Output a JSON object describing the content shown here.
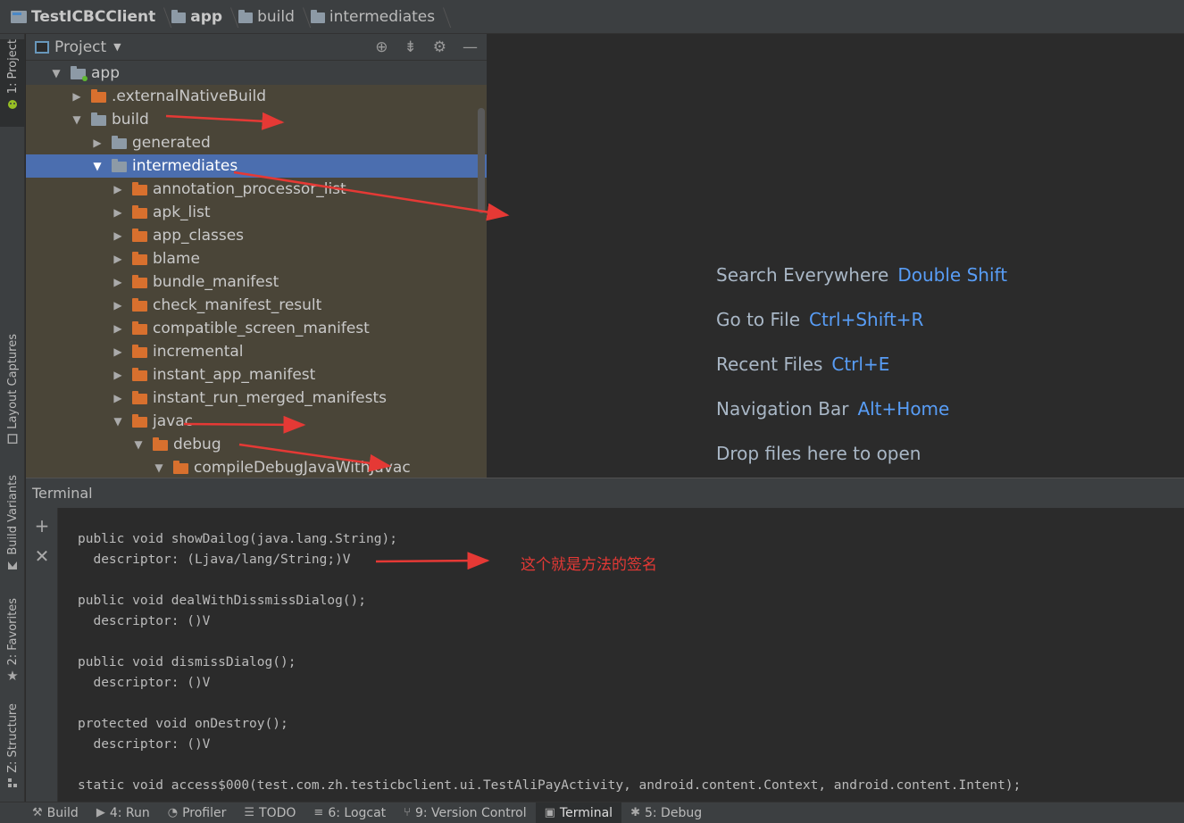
{
  "breadcrumb": [
    {
      "label": "TestICBCClient",
      "bold": true
    },
    {
      "label": "app",
      "bold": true
    },
    {
      "label": "build",
      "bold": false
    },
    {
      "label": "intermediates",
      "bold": false
    }
  ],
  "left_strip": {
    "project": "1: Project",
    "layout_captures": "Layout Captures",
    "build_variants": "Build Variants",
    "favorites": "2: Favorites",
    "structure": "Z: Structure"
  },
  "project_panel": {
    "title": "Project",
    "tree": [
      {
        "label": "app",
        "depth": 0,
        "expanded": true,
        "icon": "app-module-folder",
        "color": "grey"
      },
      {
        "label": ".externalNativeBuild",
        "depth": 1,
        "expanded": false,
        "icon": "folder",
        "color": "orange"
      },
      {
        "label": "build",
        "depth": 1,
        "expanded": true,
        "icon": "folder",
        "color": "grey"
      },
      {
        "label": "generated",
        "depth": 2,
        "expanded": false,
        "icon": "folder",
        "color": "grey"
      },
      {
        "label": "intermediates",
        "depth": 2,
        "expanded": true,
        "icon": "folder",
        "color": "grey",
        "selected": true
      },
      {
        "label": "annotation_processor_list",
        "depth": 3,
        "expanded": false,
        "icon": "folder",
        "color": "orange"
      },
      {
        "label": "apk_list",
        "depth": 3,
        "expanded": false,
        "icon": "folder",
        "color": "orange"
      },
      {
        "label": "app_classes",
        "depth": 3,
        "expanded": false,
        "icon": "folder",
        "color": "orange"
      },
      {
        "label": "blame",
        "depth": 3,
        "expanded": false,
        "icon": "folder",
        "color": "orange"
      },
      {
        "label": "bundle_manifest",
        "depth": 3,
        "expanded": false,
        "icon": "folder",
        "color": "orange"
      },
      {
        "label": "check_manifest_result",
        "depth": 3,
        "expanded": false,
        "icon": "folder",
        "color": "orange"
      },
      {
        "label": "compatible_screen_manifest",
        "depth": 3,
        "expanded": false,
        "icon": "folder",
        "color": "orange"
      },
      {
        "label": "incremental",
        "depth": 3,
        "expanded": false,
        "icon": "folder",
        "color": "orange"
      },
      {
        "label": "instant_app_manifest",
        "depth": 3,
        "expanded": false,
        "icon": "folder",
        "color": "orange"
      },
      {
        "label": "instant_run_merged_manifests",
        "depth": 3,
        "expanded": false,
        "icon": "folder",
        "color": "orange"
      },
      {
        "label": "javac",
        "depth": 3,
        "expanded": true,
        "icon": "folder",
        "color": "orange"
      },
      {
        "label": "debug",
        "depth": 4,
        "expanded": true,
        "icon": "folder",
        "color": "orange"
      },
      {
        "label": "compileDebugJavaWithJavac",
        "depth": 5,
        "expanded": true,
        "icon": "folder",
        "color": "orange"
      }
    ]
  },
  "editor_hints": [
    {
      "text": "Search Everywhere",
      "key": "Double Shift"
    },
    {
      "text": "Go to File",
      "key": "Ctrl+Shift+R"
    },
    {
      "text": "Recent Files",
      "key": "Ctrl+E"
    },
    {
      "text": "Navigation Bar",
      "key": "Alt+Home"
    },
    {
      "text": "Drop files here to open",
      "key": ""
    }
  ],
  "terminal": {
    "title": "Terminal",
    "lines": [
      "public void showDailog(java.lang.String);",
      "  descriptor: (Ljava/lang/String;)V",
      "",
      "public void dealWithDissmissDialog();",
      "  descriptor: ()V",
      "",
      "public void dismissDialog();",
      "  descriptor: ()V",
      "",
      "protected void onDestroy();",
      "  descriptor: ()V",
      "",
      "static void access$000(test.com.zh.testicbclient.ui.TestAliPayActivity, android.content.Context, android.content.Intent);"
    ],
    "annotation": "这个就是方法的签名"
  },
  "bottom_tabs": [
    {
      "label": "Build",
      "icon": "hammer-icon",
      "active": false
    },
    {
      "label": "4: Run",
      "icon": "run-icon",
      "active": false
    },
    {
      "label": "Profiler",
      "icon": "profiler-icon",
      "active": false
    },
    {
      "label": "TODO",
      "icon": "todo-icon",
      "active": false
    },
    {
      "label": "6: Logcat",
      "icon": "logcat-icon",
      "active": false
    },
    {
      "label": "9: Version Control",
      "icon": "vcs-icon",
      "active": false
    },
    {
      "label": "Terminal",
      "icon": "terminal-icon",
      "active": true
    },
    {
      "label": "5: Debug",
      "icon": "bug-icon",
      "active": false
    }
  ],
  "colors": {
    "accent_selection": "#4b6eaf",
    "shortcut_blue": "#589df6",
    "annotation_red": "#e53935",
    "folder_orange": "#d8702e"
  }
}
